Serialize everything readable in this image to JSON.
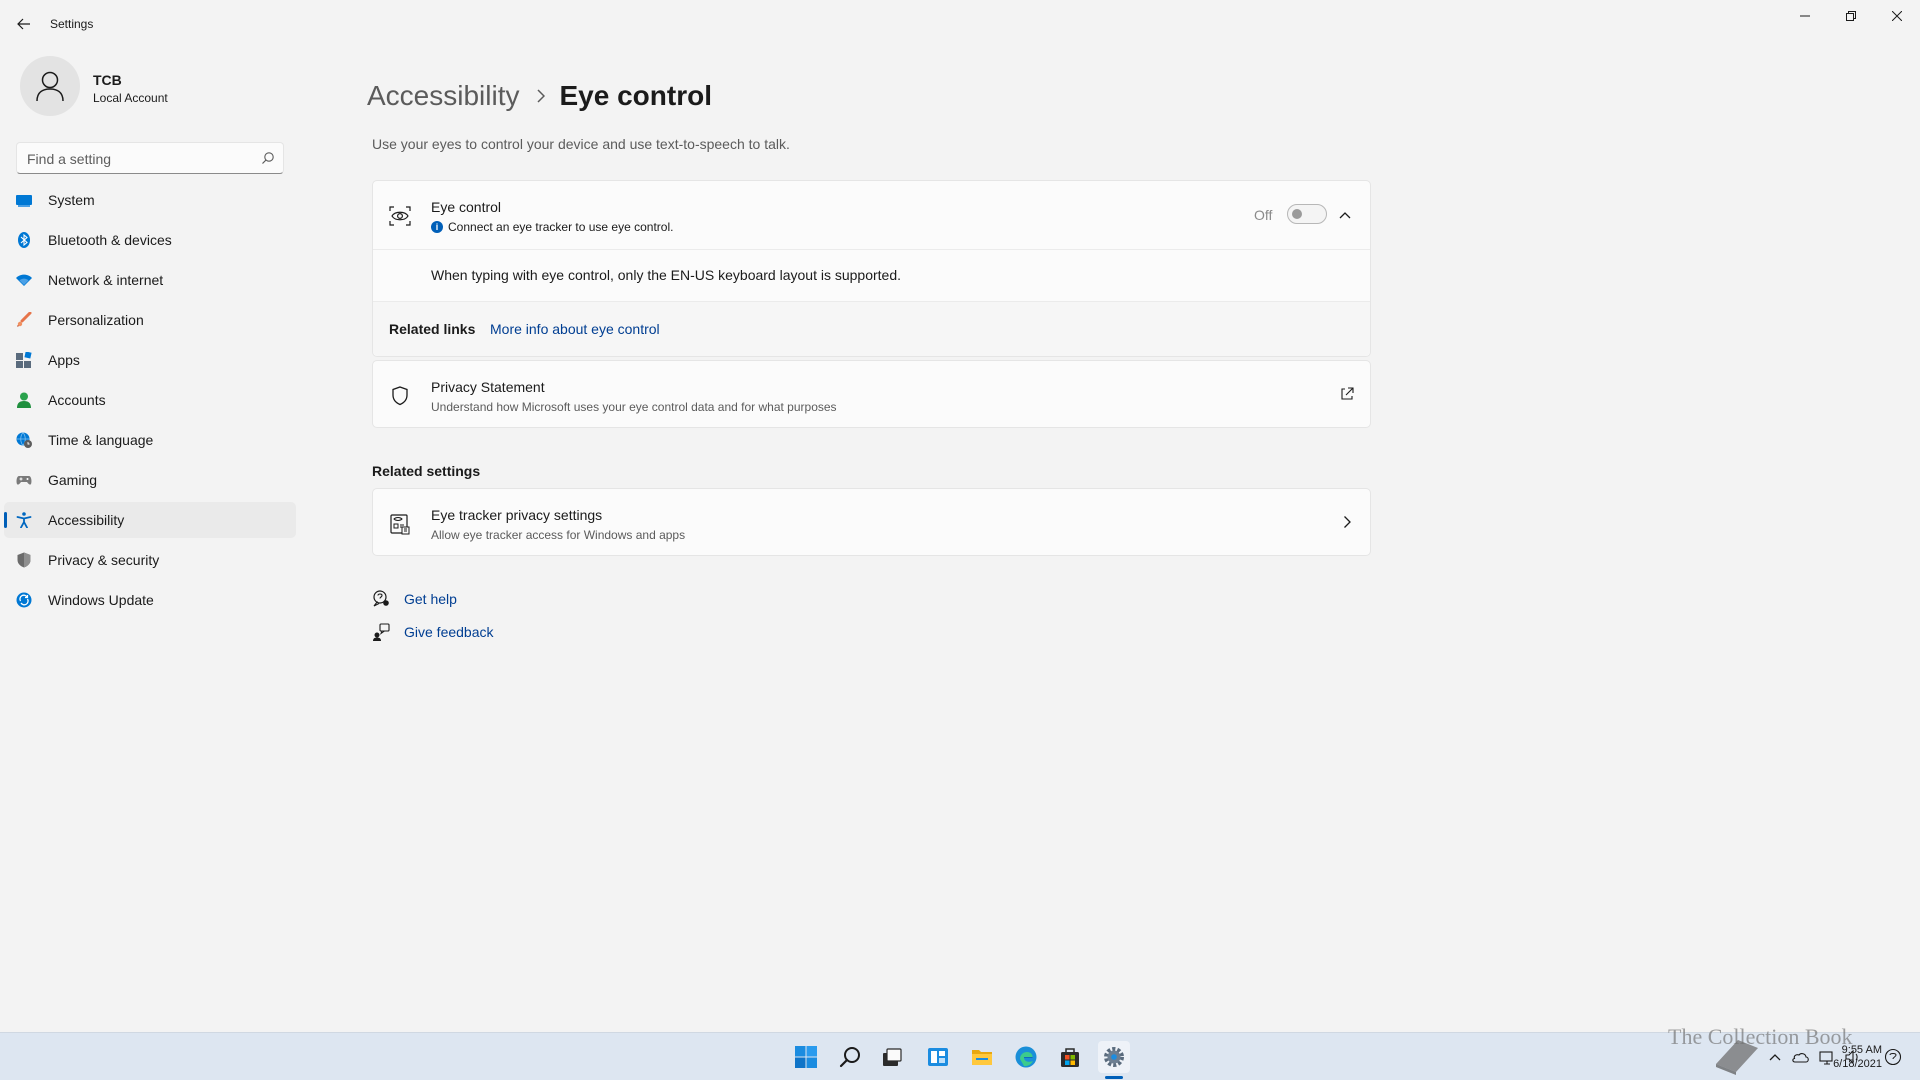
{
  "window": {
    "app_title": "Settings"
  },
  "profile": {
    "name": "TCB",
    "account_type": "Local Account"
  },
  "search": {
    "placeholder": "Find a setting",
    "value": ""
  },
  "sidebar": {
    "items": [
      {
        "label": "System",
        "icon": "system-icon",
        "color": "#0078d4"
      },
      {
        "label": "Bluetooth & devices",
        "icon": "bluetooth-icon",
        "color": "#0078d4"
      },
      {
        "label": "Network & internet",
        "icon": "wifi-icon",
        "color": "#0078d4"
      },
      {
        "label": "Personalization",
        "icon": "brush-icon",
        "color": "#e6744a"
      },
      {
        "label": "Apps",
        "icon": "apps-icon",
        "color": "#5a6b7d"
      },
      {
        "label": "Accounts",
        "icon": "person-icon",
        "color": "#2aa24c"
      },
      {
        "label": "Time & language",
        "icon": "globe-clock-icon",
        "color": "#0078d4"
      },
      {
        "label": "Gaming",
        "icon": "gamepad-icon",
        "color": "#7a7a7a"
      },
      {
        "label": "Accessibility",
        "icon": "accessibility-icon",
        "color": "#0067c0",
        "selected": true
      },
      {
        "label": "Privacy & security",
        "icon": "shield-icon",
        "color": "#6b6b6b"
      },
      {
        "label": "Windows Update",
        "icon": "update-icon",
        "color": "#0078d4"
      }
    ]
  },
  "main": {
    "breadcrumb_parent": "Accessibility",
    "page_title": "Eye control",
    "description": "Use your eyes to control your device and use text-to-speech to talk.",
    "eye_control": {
      "title": "Eye control",
      "subtitle": "Connect an eye tracker to use eye control.",
      "toggle_label": "Off",
      "toggle_on": false,
      "note": "When typing with eye control, only the EN-US keyboard layout is supported.",
      "related_links_label": "Related links",
      "related_link": "More info about eye control"
    },
    "privacy": {
      "title": "Privacy Statement",
      "subtitle": "Understand how Microsoft uses your eye control data and for what purposes"
    },
    "related_settings_title": "Related settings",
    "tracker": {
      "title": "Eye tracker privacy settings",
      "subtitle": "Allow eye tracker access for Windows and apps"
    },
    "get_help": "Get help",
    "give_feedback": "Give feedback"
  },
  "taskbar": {
    "icons": [
      "windows-start-icon",
      "search-icon",
      "task-view-icon",
      "widgets-icon",
      "file-explorer-icon",
      "edge-icon",
      "store-icon",
      "settings-icon"
    ],
    "active": "settings-icon",
    "time": "9:55 AM",
    "date": "6/18/2021"
  },
  "watermark": {
    "text": "The Collection Book"
  },
  "colors": {
    "accent": "#005fb8",
    "link": "#003e92",
    "background": "#f3f3f3",
    "card": "#fbfbfb"
  }
}
